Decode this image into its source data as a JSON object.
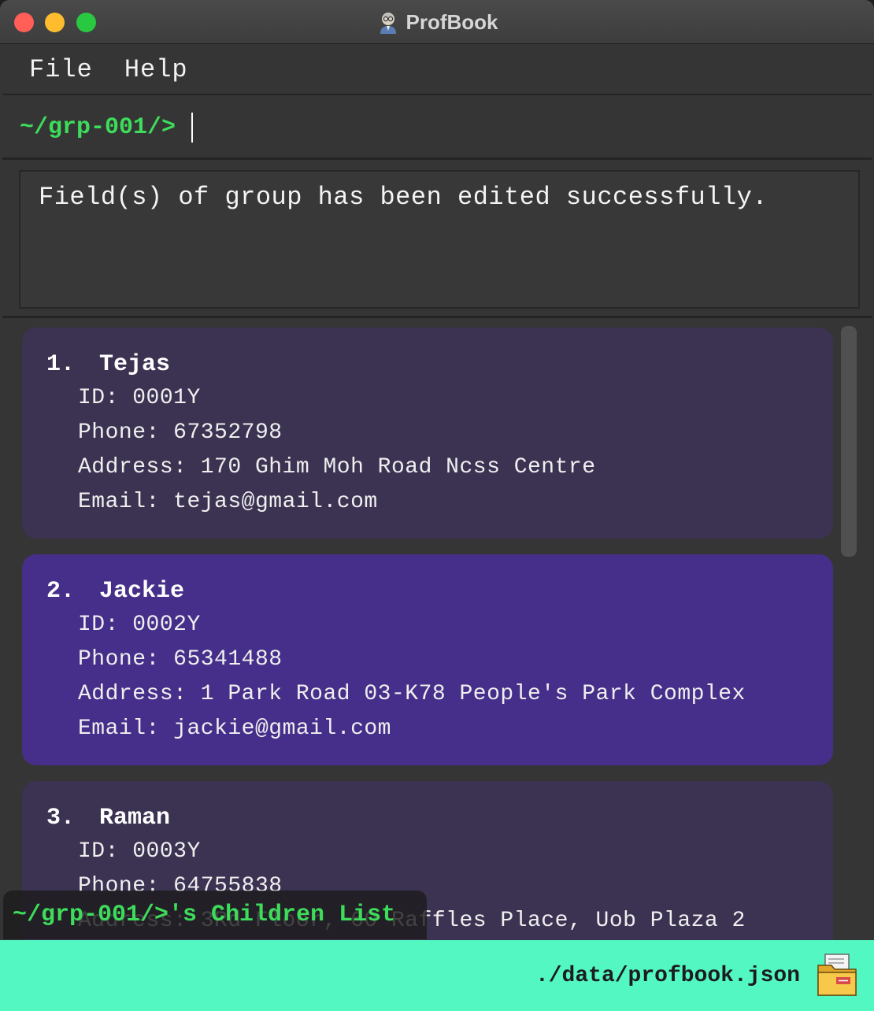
{
  "window": {
    "title": "ProfBook"
  },
  "menu": {
    "file": "File",
    "help": "Help"
  },
  "command": {
    "prompt": "~/grp-001/>",
    "value": ""
  },
  "result": {
    "message": "Field(s) of group has been edited successfully."
  },
  "list": {
    "title": "~/grp-001/>'s Children List",
    "labels": {
      "id": "ID:",
      "phone": "Phone:",
      "address": "Address:",
      "email": "Email:"
    },
    "cards": [
      {
        "index": "1.",
        "name": "Tejas",
        "id": "0001Y",
        "phone": "67352798",
        "address": "170 Ghim Moh Road Ncss Centre",
        "email": "tejas@gmail.com",
        "selected": false
      },
      {
        "index": "2.",
        "name": "Jackie",
        "id": "0002Y",
        "phone": "65341488",
        "address": "1 Park Road 03-K78 People's Park Complex",
        "email": "jackie@gmail.com",
        "selected": true
      },
      {
        "index": "3.",
        "name": "Raman",
        "id": "0003Y",
        "phone": "64755838",
        "address": "3Rd Floor, 60 Raffles Place, Uob Plaza 2",
        "email": "",
        "selected": false
      }
    ]
  },
  "status": {
    "save_location": "./data/profbook.json"
  },
  "colors": {
    "accent_green": "#3ddc5a",
    "status_bar": "#52f7c2",
    "card": "#3c3352",
    "card_selected": "#462f8a"
  },
  "icons": {
    "app": "professor-icon",
    "status": "folder-icon"
  }
}
